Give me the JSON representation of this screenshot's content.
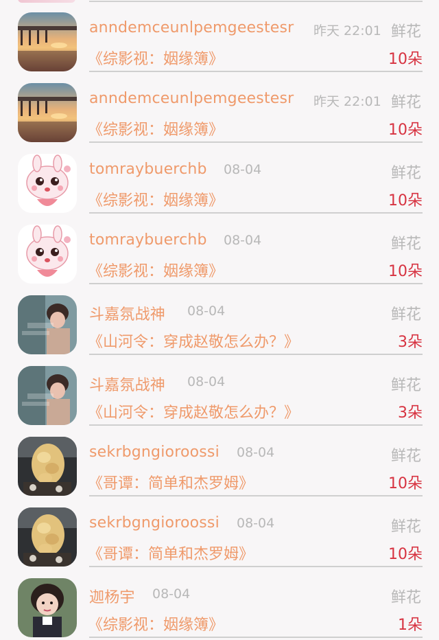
{
  "gift_list": [
    {
      "avatar": "sunset-pier-avatar",
      "user": "anndemceunlpemgeestesr",
      "time": "昨天 22:01",
      "gift_type": "鲜花",
      "book": "《综影视：姻缘簿》",
      "count": "10朵"
    },
    {
      "avatar": "sunset-pier-avatar",
      "user": "anndemceunlpemgeestesr",
      "time": "昨天 22:01",
      "gift_type": "鲜花",
      "book": "《综影视：姻缘簿》",
      "count": "10朵"
    },
    {
      "avatar": "cartoon-rabbit-avatar",
      "user": "tomraybuerchb",
      "time": "08-04",
      "gift_type": "鲜花",
      "book": "《综影视：姻缘簿》",
      "count": "10朵"
    },
    {
      "avatar": "cartoon-rabbit-avatar",
      "user": "tomraybuerchb",
      "time": "08-04",
      "gift_type": "鲜花",
      "book": "《综影视：姻缘簿》",
      "count": "10朵"
    },
    {
      "avatar": "child-photo-avatar",
      "user": "斗嘉氛战神",
      "time": "08-04",
      "gift_type": "鲜花",
      "book": "《山河令：穿成赵敬怎么办？》",
      "count": "3朵"
    },
    {
      "avatar": "child-photo-avatar",
      "user": "斗嘉氛战神",
      "time": "08-04",
      "gift_type": "鲜花",
      "book": "《山河令：穿成赵敬怎么办？》",
      "count": "3朵"
    },
    {
      "avatar": "braided-hair-avatar",
      "user": "sekrbgngioroossi",
      "time": "08-04",
      "gift_type": "鲜花",
      "book": "《哥谭：简单和杰罗姆》",
      "count": "10朵"
    },
    {
      "avatar": "braided-hair-avatar",
      "user": "sekrbgngioroossi",
      "time": "08-04",
      "gift_type": "鲜花",
      "book": "《哥谭：简单和杰罗姆》",
      "count": "10朵"
    },
    {
      "avatar": "little-girl-avatar",
      "user": "迦杨宇",
      "time": "08-04",
      "gift_type": "鲜花",
      "book": "《综影视：姻缘簿》",
      "count": "1朵"
    }
  ],
  "colors": {
    "accent_orange": "#ef9a6b",
    "count_red": "#d73341",
    "meta_gray": "#b8b8b8",
    "background": "#f8f6f7"
  }
}
